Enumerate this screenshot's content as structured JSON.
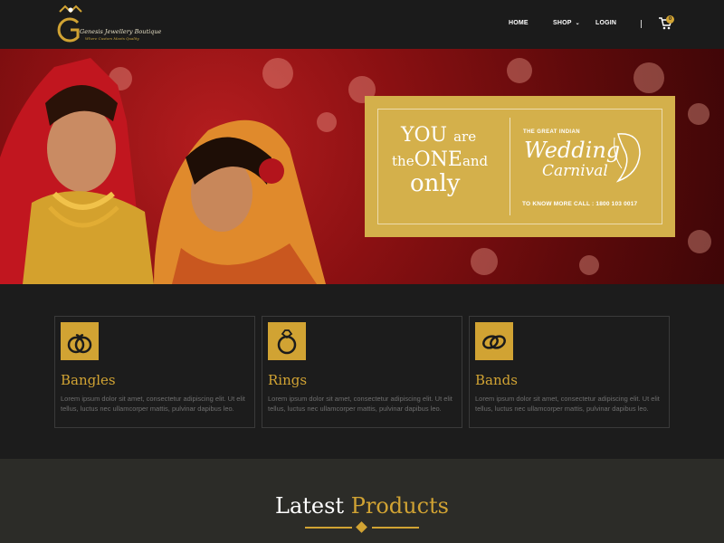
{
  "header": {
    "brand_name": "Genesis Jewellery Boutique",
    "brand_tagline": "Where Custom Meets Quality",
    "nav": {
      "home": "HOME",
      "shop": "SHOP",
      "login": "LOGIN"
    },
    "cart_count": "0",
    "icons": [
      "logo-icon",
      "chevron-down-icon",
      "cart-icon"
    ]
  },
  "hero": {
    "ticket": {
      "line1_big": "YOU",
      "line1_small": "are",
      "line2_small": "the",
      "line2_big": "ONE",
      "line2_end": "and",
      "line3": "only",
      "event_kicker": "THE GREAT INDIAN",
      "event_title_1": "Wedding",
      "event_title_2": "Carnival",
      "contact": "TO KNOW MORE CALL : 1800 103 0017"
    }
  },
  "categories": [
    {
      "title": "Bangles",
      "icon": "bangles-icon",
      "desc": "Lorem ipsum dolor sit amet, consectetur adipiscing elit. Ut elit tellus, luctus nec ullamcorper mattis, pulvinar dapibus leo."
    },
    {
      "title": "Rings",
      "icon": "ring-icon",
      "desc": "Lorem ipsum dolor sit amet, consectetur adipiscing elit. Ut elit tellus, luctus nec ullamcorper mattis, pulvinar dapibus leo."
    },
    {
      "title": "Bands",
      "icon": "bands-icon",
      "desc": "Lorem ipsum dolor sit amet, consectetur adipiscing elit. Ut elit tellus, luctus nec ullamcorper mattis, pulvinar dapibus leo."
    }
  ],
  "latest": {
    "word1": "Latest",
    "word2": "Products"
  },
  "colors": {
    "gold": "#d1a333",
    "dark": "#1c1c1c",
    "section": "#2c2c28",
    "hero_red": "#8a1012"
  }
}
